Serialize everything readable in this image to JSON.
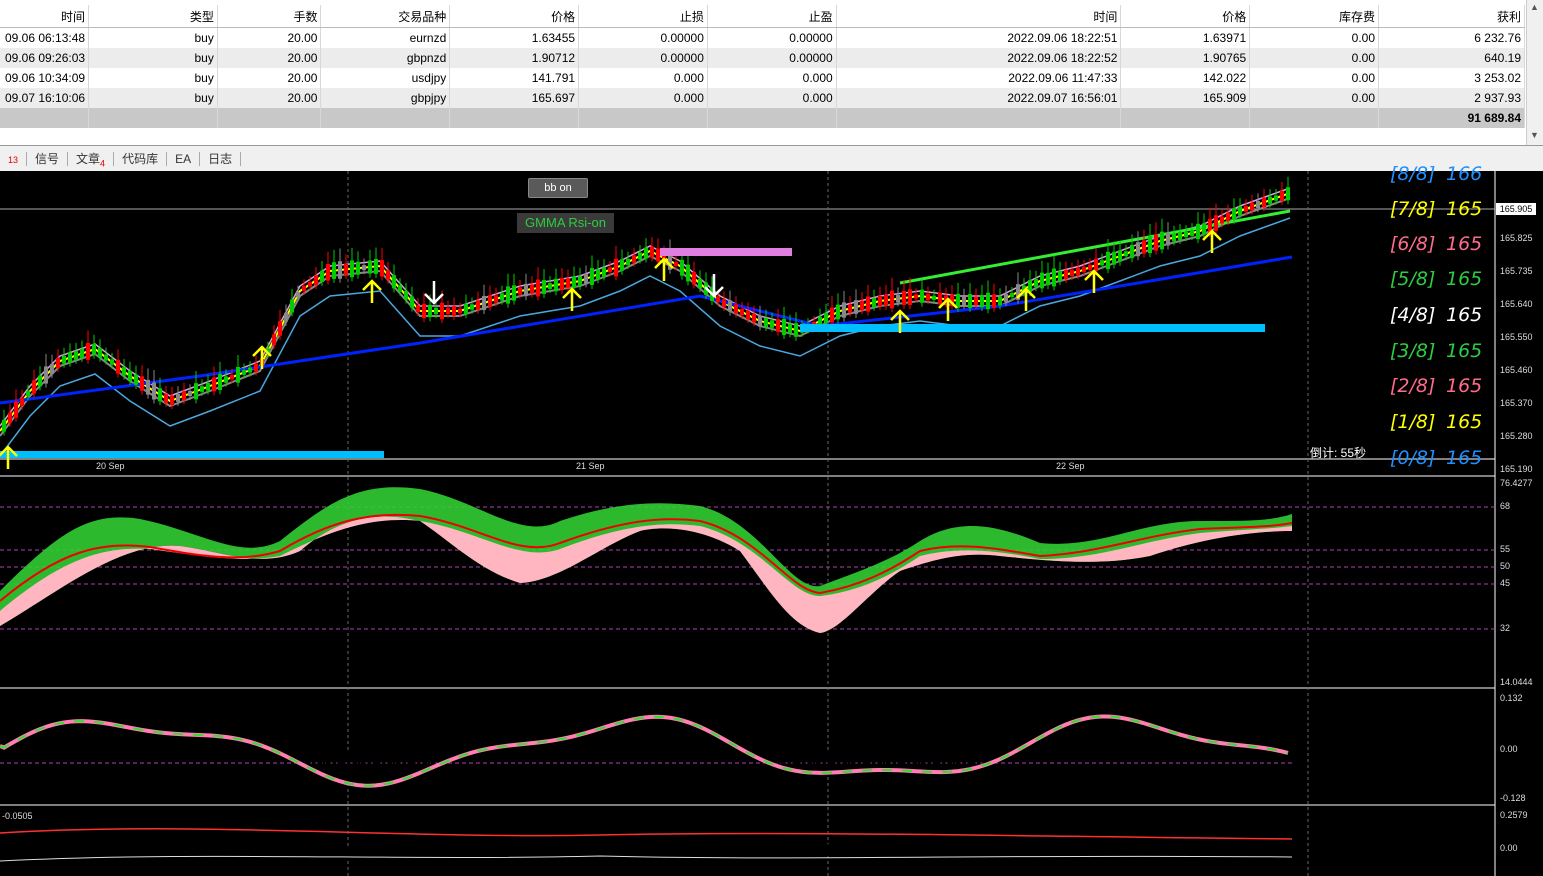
{
  "trade_table": {
    "columns": [
      "时间",
      "类型",
      "手数",
      "交易品种",
      "价格",
      "止损",
      "止盈",
      "时间",
      "价格",
      "库存费",
      "获利"
    ],
    "rows": [
      [
        "09.06 06:13:48",
        "buy",
        "20.00",
        "eurnzd",
        "1.63455",
        "0.00000",
        "0.00000",
        "2022.09.06 18:22:51",
        "1.63971",
        "0.00",
        "6 232.76"
      ],
      [
        "09.06 09:26:03",
        "buy",
        "20.00",
        "gbpnzd",
        "1.90712",
        "0.00000",
        "0.00000",
        "2022.09.06 18:22:52",
        "1.90765",
        "0.00",
        "640.19"
      ],
      [
        "09.06 10:34:09",
        "buy",
        "20.00",
        "usdjpy",
        "141.791",
        "0.000",
        "0.000",
        "2022.09.06 11:47:33",
        "142.022",
        "0.00",
        "3 253.02"
      ],
      [
        "09.07 16:10:06",
        "buy",
        "20.00",
        "gbpjpy",
        "165.697",
        "0.000",
        "0.000",
        "2022.09.07 16:56:01",
        "165.909",
        "0.00",
        "2 937.93"
      ]
    ],
    "total": "91 689.84"
  },
  "tabs": [
    {
      "label": "13",
      "badge": ""
    },
    {
      "label": "信号",
      "badge": ""
    },
    {
      "label": "文章",
      "badge": "4"
    },
    {
      "label": "代码库",
      "badge": ""
    },
    {
      "label": "EA",
      "badge": ""
    },
    {
      "label": "日志",
      "badge": ""
    }
  ],
  "chart": {
    "buttons": {
      "bb": "bb on",
      "gmma": "GMMA Rsi-on"
    },
    "current_price": "165.905",
    "countdown": "倒计: 55秒",
    "date_labels": [
      "20 Sep",
      "21 Sep",
      "22 Sep"
    ],
    "murrey_levels": [
      {
        "level": "[8/8]",
        "value": "166",
        "color": "#1e90ff"
      },
      {
        "level": "[7/8]",
        "value": "165",
        "color": "#ffff00"
      },
      {
        "level": "[6/8]",
        "value": "165",
        "color": "#ff6b8a"
      },
      {
        "level": "[5/8]",
        "value": "165",
        "color": "#2ecc40"
      },
      {
        "level": "[4/8]",
        "value": "165",
        "color": "#ffffff"
      },
      {
        "level": "[3/8]",
        "value": "165",
        "color": "#2ecc40"
      },
      {
        "level": "[2/8]",
        "value": "165",
        "color": "#ff6b8a"
      },
      {
        "level": "[1/8]",
        "value": "165",
        "color": "#ffff00"
      },
      {
        "level": "[0/8]",
        "value": "165",
        "color": "#1e90ff"
      }
    ],
    "price_ticks": [
      "165.825",
      "165.735",
      "165.640",
      "165.550",
      "165.460",
      "165.370",
      "165.280",
      "165.190"
    ],
    "rsi_ticks": [
      "76.4277",
      "68",
      "55",
      "50",
      "45",
      "32",
      "14.0444"
    ],
    "macd_ticks": [
      "0.132",
      "0.00",
      "-0.128"
    ],
    "osc_label": "-0.0505",
    "osc_ticks": [
      "0.2579",
      "0.00"
    ],
    "colors": {
      "bull": "#00cc00",
      "bear": "#ff0000",
      "ma_blue": "#0022ff",
      "band": "#00bfff",
      "rsi_green": "#32cd32",
      "rsi_pink": "#ffb6c1"
    }
  }
}
